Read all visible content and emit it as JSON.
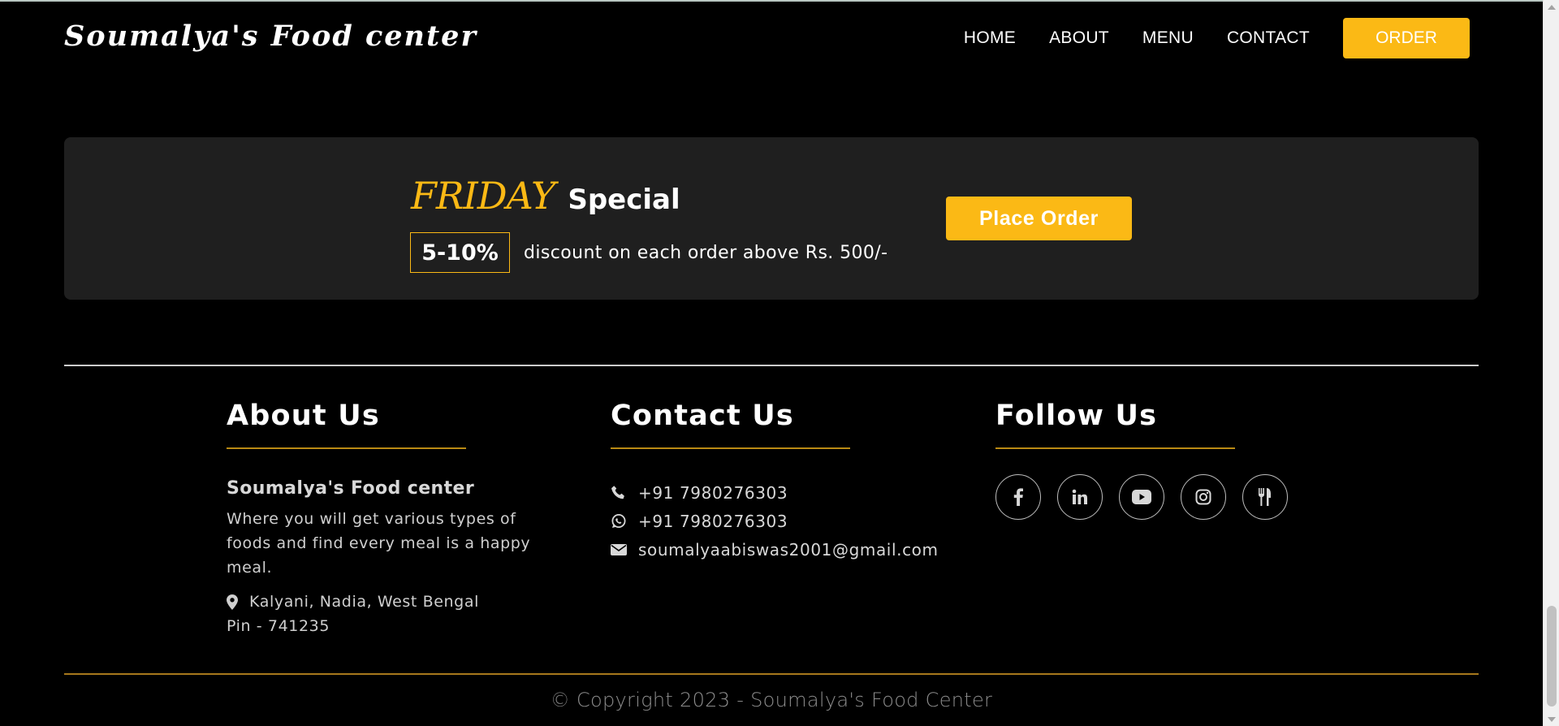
{
  "header": {
    "brand": "Soumalya's Food center",
    "nav": [
      "HOME",
      "ABOUT",
      "MENU",
      "CONTACT"
    ],
    "order_label": "ORDER"
  },
  "special": {
    "highlight": "FRIDAY",
    "title": "Special",
    "discount": "5-10%",
    "discount_text": "discount on each order above Rs. 500/-",
    "button_label": "Place Order"
  },
  "footer": {
    "about": {
      "title": "About Us",
      "name": "Soumalya's Food center",
      "description": "Where you will get various types of foods and find every meal is a happy meal.",
      "address_line1": "Kalyani, Nadia, West Bengal",
      "address_line2": "Pin - 741235"
    },
    "contact": {
      "title": "Contact Us",
      "phone": "+91 7980276303",
      "whatsapp": "+91 7980276303",
      "email": "soumalyaabiswas2001@gmail.com"
    },
    "follow": {
      "title": "Follow Us",
      "icons": [
        "facebook-icon",
        "linkedin-icon",
        "youtube-icon",
        "instagram-icon",
        "utensils-icon"
      ]
    },
    "copyright": "© Copyright 2023 - Soumalya's Food Center"
  },
  "colors": {
    "accent": "#fbb915",
    "background": "#000000",
    "panel": "#1f1f1f",
    "divider_gold": "#a6781c"
  }
}
